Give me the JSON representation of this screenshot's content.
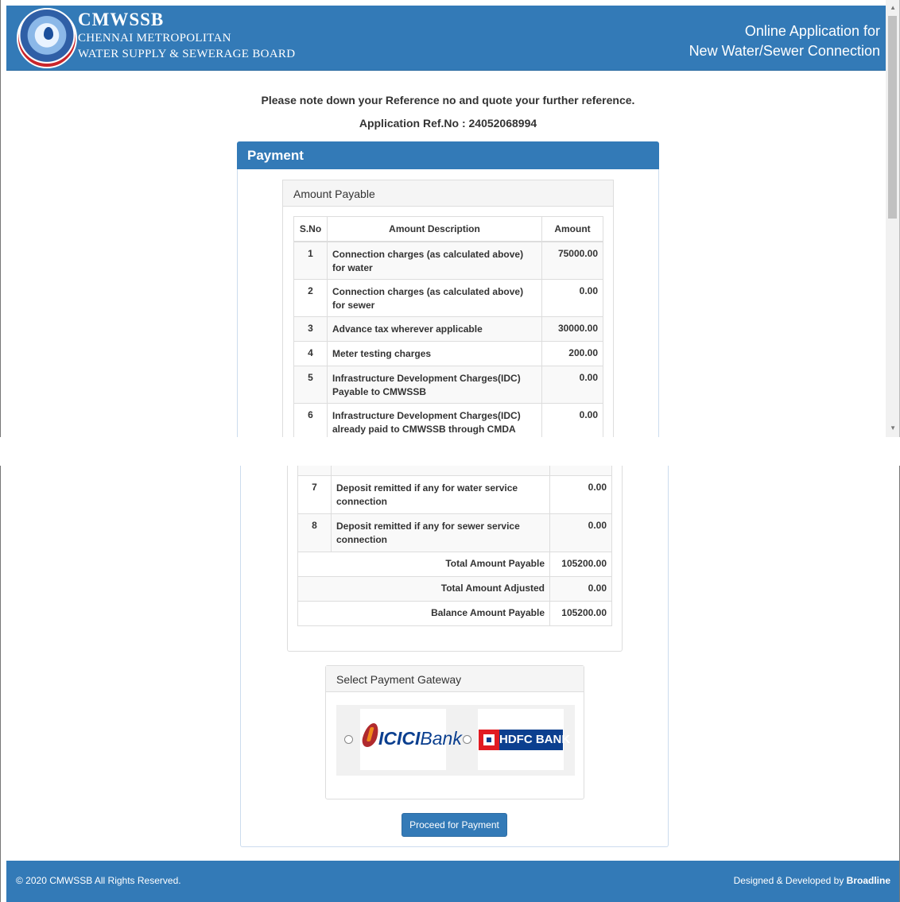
{
  "header": {
    "brand_title": "CMWSSB",
    "brand_line1": "CHENNAI METROPOLITAN",
    "brand_line2": "WATER SUPPLY & SEWERAGE BOARD",
    "right_line1": "Online Application for",
    "right_line2": "New Water/Sewer Connection"
  },
  "notice": {
    "line1": "Please note down your Reference no and quote your further reference.",
    "ref_label": "Application Ref.No : 24052068994"
  },
  "payment": {
    "title": "Payment",
    "amount_payable_title": "Amount Payable",
    "columns": [
      "S.No",
      "Amount Description",
      "Amount"
    ],
    "rows": [
      {
        "sno": "1",
        "desc": "Connection charges (as calculated above) for water",
        "amount": "75000.00"
      },
      {
        "sno": "2",
        "desc": "Connection charges (as calculated above) for sewer",
        "amount": "0.00"
      },
      {
        "sno": "3",
        "desc": "Advance tax wherever applicable",
        "amount": "30000.00"
      },
      {
        "sno": "4",
        "desc": "Meter testing charges",
        "amount": "200.00"
      },
      {
        "sno": "5",
        "desc": "Infrastructure Development Charges(IDC) Payable to CMWSSB",
        "amount": "0.00"
      },
      {
        "sno": "6",
        "desc": "Infrastructure Development Charges(IDC) already paid to CMWSSB through CMDA",
        "amount": "0.00"
      },
      {
        "sno": "7",
        "desc": "Deposit remitted if any for water service connection",
        "amount": "0.00"
      },
      {
        "sno": "8",
        "desc": "Deposit remitted if any for sewer service connection",
        "amount": "0.00"
      }
    ],
    "totals": [
      {
        "label": "Total Amount Payable",
        "amount": "105200.00"
      },
      {
        "label": "Total Amount Adjusted",
        "amount": "0.00"
      },
      {
        "label": "Balance Amount Payable",
        "amount": "105200.00"
      }
    ],
    "gateway_title": "Select Payment Gateway",
    "gateways": [
      {
        "name": "ICICI Bank",
        "brand": "ICICI",
        "brand_suffix": "Bank",
        "icon": "icici-logo-icon"
      },
      {
        "name": "HDFC BANK",
        "brand": "HDFC BANK",
        "icon": "hdfc-logo-icon"
      }
    ],
    "proceed_label": "Proceed for Payment"
  },
  "footer": {
    "left": "© 2020 CMWSSB All Rights Reserved.",
    "right_prefix": "Designed & Developed by ",
    "right_brand": "Broadline"
  },
  "colors": {
    "primary": "#337ab7",
    "panel_bg": "#f5f5f5",
    "icici_red": "#b02a2e",
    "hdfc_blue": "#0b3f8f",
    "hdfc_red": "#e11b22"
  }
}
